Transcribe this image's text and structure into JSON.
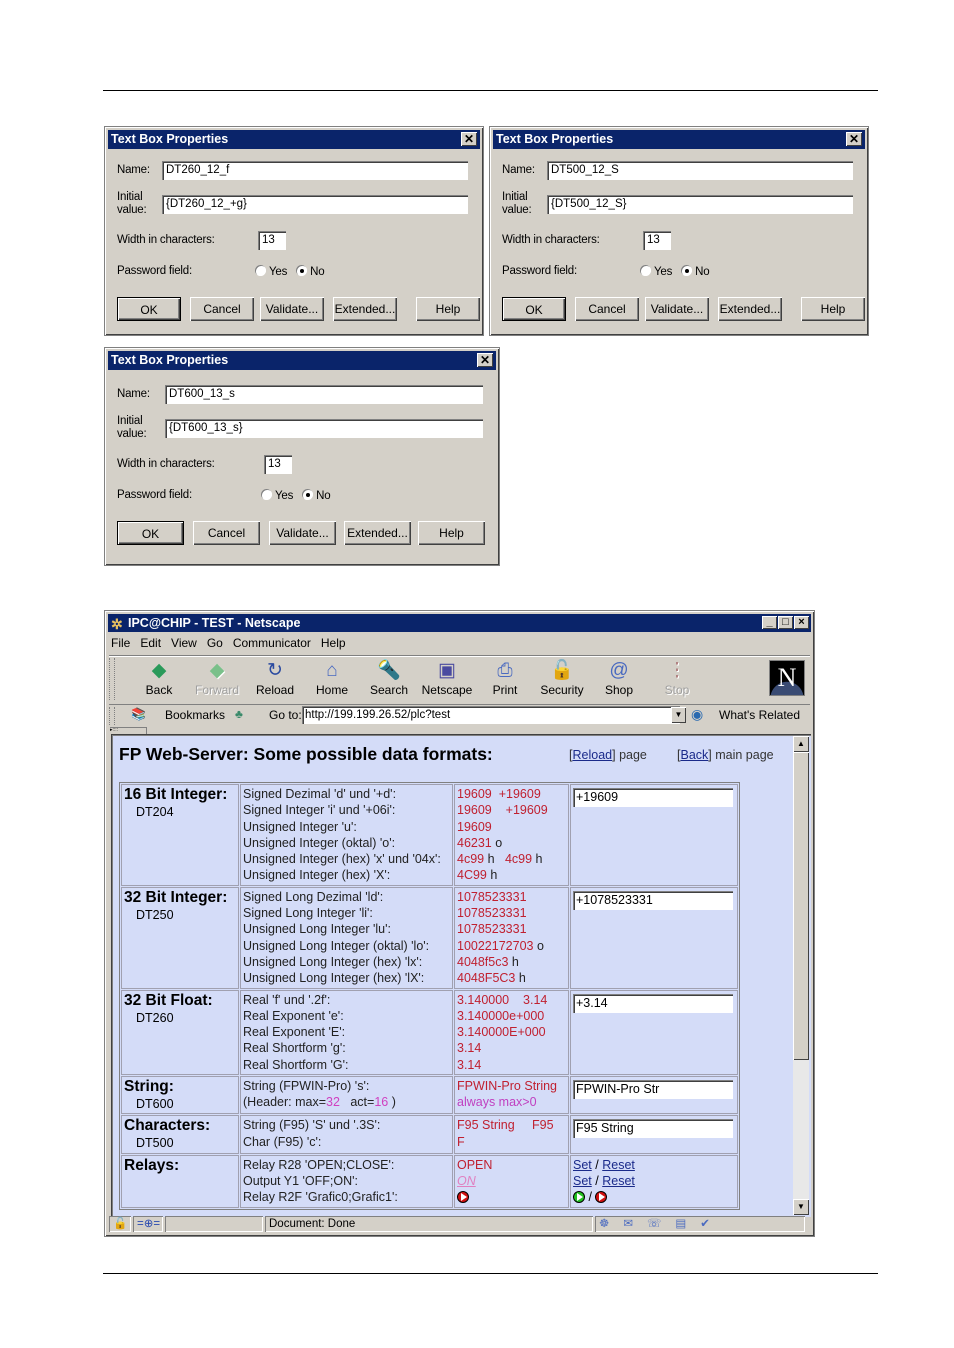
{
  "dialogs": [
    {
      "title": "Text Box Properties",
      "name_label": "Name:",
      "name_value": "DT260_12_f",
      "initial_label_1": "Initial",
      "initial_label_2": "value:",
      "initial_value": "{DT260_12_+g}",
      "width_label": "Width in characters:",
      "width_value": "13",
      "password_label": "Password field:",
      "yes_label": "Yes",
      "no_label": "No",
      "password_selected": "No",
      "buttons": [
        "OK",
        "Cancel",
        "Validate...",
        "Extended...",
        "Help"
      ]
    },
    {
      "title": "Text Box Properties",
      "name_label": "Name:",
      "name_value": "DT500_12_S",
      "initial_label_1": "Initial",
      "initial_label_2": "value:",
      "initial_value": "{DT500_12_S}",
      "width_label": "Width in characters:",
      "width_value": "13",
      "password_label": "Password field:",
      "yes_label": "Yes",
      "no_label": "No",
      "password_selected": "No",
      "buttons": [
        "OK",
        "Cancel",
        "Validate...",
        "Extended...",
        "Help"
      ]
    },
    {
      "title": "Text Box Properties",
      "name_label": "Name:",
      "name_value": "DT600_13_s",
      "initial_label_1": "Initial",
      "initial_label_2": "value:",
      "initial_value": "{DT600_13_s}",
      "width_label": "Width in characters:",
      "width_value": "13",
      "password_label": "Password field:",
      "yes_label": "Yes",
      "no_label": "No",
      "password_selected": "No",
      "buttons": [
        "OK",
        "Cancel",
        "Validate...",
        "Extended...",
        "Help"
      ]
    }
  ],
  "browser": {
    "title": "IPC@CHIP - TEST - Netscape",
    "window_buttons": [
      "_",
      "□",
      "×"
    ],
    "menu": [
      "File",
      "Edit",
      "View",
      "Go",
      "Communicator",
      "Help"
    ],
    "toolbar": [
      {
        "label": "Back",
        "icon": "back-arrow-icon",
        "glyph": "◆",
        "color": "#2a9a5a",
        "disabled": false
      },
      {
        "label": "Forward",
        "icon": "forward-arrow-icon",
        "glyph": "◆",
        "color": "#7ac08a",
        "disabled": true
      },
      {
        "label": "Reload",
        "icon": "reload-icon",
        "glyph": "↻",
        "color": "#2a4aa0",
        "disabled": false
      },
      {
        "label": "Home",
        "icon": "home-icon",
        "glyph": "⌂",
        "color": "#4a6ac0",
        "disabled": false
      },
      {
        "label": "Search",
        "icon": "search-flashlight-icon",
        "glyph": "🔦",
        "color": "#4a6ac0",
        "disabled": false
      },
      {
        "label": "Netscape",
        "icon": "my-netscape-icon",
        "glyph": "▣",
        "color": "#4a4aa0",
        "disabled": false
      },
      {
        "label": "Print",
        "icon": "printer-icon",
        "glyph": "⎙",
        "color": "#4a6ac0",
        "disabled": false
      },
      {
        "label": "Security",
        "icon": "padlock-icon",
        "glyph": "🔓",
        "color": "#a03020",
        "disabled": false
      },
      {
        "label": "Shop",
        "icon": "shopping-bag-icon",
        "glyph": "@",
        "color": "#4a6ac0",
        "disabled": false
      },
      {
        "label": "Stop",
        "icon": "stop-light-icon",
        "glyph": "⋮",
        "color": "#b08080",
        "disabled": true
      }
    ],
    "bookmarks_label": "Bookmarks",
    "goto_label": "Go to:",
    "url": "http://199.199.26.52/plc?test",
    "whats_related": "What's Related",
    "status_text": "Document: Done"
  },
  "page": {
    "heading": "FP Web-Server: Some possible data formats:",
    "reload_link": "Reload",
    "reload_suffix": "page",
    "back_link": "Back",
    "back_suffix": "main page",
    "rows": [
      {
        "type": "16 Bit Integer:",
        "register": "DT204",
        "descriptions": [
          "Signed Dezimal 'd' und '+d':",
          "Signed Integer 'i' und '+06i':",
          "Unsigned Integer 'u':",
          "Unsigned Integer (oktal) 'o':",
          "Unsigned Integer (hex) 'x' und '04x':",
          "Unsigned Integer (hex) 'X':"
        ],
        "values": [
          [
            {
              "t": "19609  +19609",
              "c": "v"
            }
          ],
          [
            {
              "t": "19609    +19609",
              "c": "v"
            }
          ],
          [
            {
              "t": "19609",
              "c": "v"
            }
          ],
          [
            {
              "t": "46231",
              "c": "v"
            },
            {
              "t": " o",
              "c": "k"
            }
          ],
          [
            {
              "t": "4c99",
              "c": "v"
            },
            {
              "t": " h   ",
              "c": "k"
            },
            {
              "t": "4c99",
              "c": "v"
            },
            {
              "t": " h",
              "c": "k"
            }
          ],
          [
            {
              "t": "4C99",
              "c": "v"
            },
            {
              "t": " h",
              "c": "k"
            }
          ]
        ],
        "input_value": "+19609"
      },
      {
        "type": "32 Bit Integer:",
        "register": "DT250",
        "descriptions": [
          "Signed Long Dezimal 'ld':",
          "Signed Long Integer 'li':",
          "Unsigned Long Integer 'lu':",
          "Unsigned Long Integer (oktal) 'lo':",
          "Unsigned Long Integer (hex) 'lx':",
          "Unsigned Long Integer (hex) 'lX':"
        ],
        "values": [
          [
            {
              "t": "1078523331",
              "c": "v"
            }
          ],
          [
            {
              "t": "1078523331",
              "c": "v"
            }
          ],
          [
            {
              "t": "1078523331",
              "c": "v"
            }
          ],
          [
            {
              "t": "10022172703",
              "c": "v"
            },
            {
              "t": " o",
              "c": "k"
            }
          ],
          [
            {
              "t": "4048f5c3",
              "c": "v"
            },
            {
              "t": " h",
              "c": "k"
            }
          ],
          [
            {
              "t": "4048F5C3",
              "c": "v"
            },
            {
              "t": " h",
              "c": "k"
            }
          ]
        ],
        "input_value": "+1078523331"
      },
      {
        "type": "32 Bit Float:",
        "register": "DT260",
        "descriptions": [
          "Real 'f' und '.2f':",
          "Real Exponent 'e':",
          "Real Exponent 'E':",
          "Real Shortform 'g':",
          "Real Shortform 'G':"
        ],
        "values": [
          [
            {
              "t": "3.140000    3.14",
              "c": "v"
            }
          ],
          [
            {
              "t": "3.140000e+000",
              "c": "v"
            }
          ],
          [
            {
              "t": "3.140000E+000",
              "c": "v"
            }
          ],
          [
            {
              "t": "3.14",
              "c": "v"
            }
          ],
          [
            {
              "t": "3.14",
              "c": "v"
            }
          ]
        ],
        "input_value": "+3.14"
      },
      {
        "type": "String:",
        "register": "DT600",
        "descriptions": [
          "String (FPWIN-Pro) 's':"
        ],
        "header_line": {
          "prefix": "(Header: max=",
          "max": "32",
          "mid": "   act=",
          "act": "16",
          "suffix": " )"
        },
        "values": [
          [
            {
              "t": "FPWIN-Pro String",
              "c": "v"
            }
          ],
          [
            {
              "t": "always max>0",
              "c": "m"
            }
          ]
        ],
        "input_value": "FPWIN-Pro Str"
      },
      {
        "type": "Characters:",
        "register": "DT500",
        "descriptions": [
          "String (F95) 'S' und '.3S':",
          "Char (F95) 'c':"
        ],
        "values": [
          [
            {
              "t": "F95 String     F95",
              "c": "v"
            }
          ],
          [
            {
              "t": "F",
              "c": "v"
            }
          ]
        ],
        "input_value": "F95 String"
      }
    ],
    "relays": {
      "type": "Relays:",
      "descriptions": [
        "Relay R28 'OPEN;CLOSE':",
        "Output Y1 'OFF;ON':",
        "Relay R2F 'Grafic0;Grafic1':"
      ],
      "r28_value": "OPEN",
      "y1_value": "ON",
      "r2f_state": "red-play",
      "set_label": "Set",
      "reset_label": "Reset",
      "separator": "/"
    }
  }
}
